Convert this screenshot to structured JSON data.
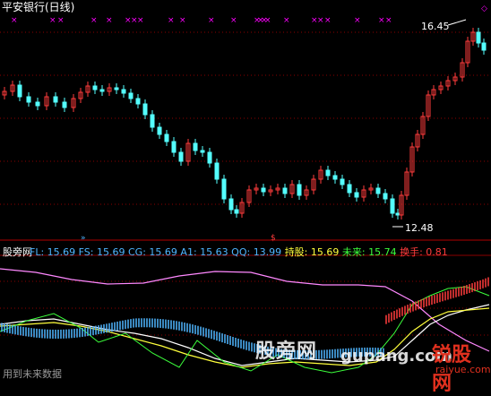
{
  "header": {
    "title": "平安银行(日线)"
  },
  "price_pane": {
    "high_label": "16.45",
    "low_label": "12.48"
  },
  "indicator_pane": {
    "name": "股旁网",
    "items": [
      {
        "label": "FL: ",
        "value": "15.69",
        "color": "#4fb5ff"
      },
      {
        "label": "FS: ",
        "value": "15.69",
        "color": "#4fb5ff"
      },
      {
        "label": "CG: ",
        "value": "15.69",
        "color": "#4fb5ff"
      },
      {
        "label": "A1: ",
        "value": "15.63",
        "color": "#4fb5ff"
      },
      {
        "label": "QQ: ",
        "value": "13.99",
        "color": "#4fb5ff"
      },
      {
        "label": "持股: ",
        "value": "15.69",
        "color": "#ffff3c"
      },
      {
        "label": "未来: ",
        "value": "15.74",
        "color": "#3cff3c"
      },
      {
        "label": "换手: ",
        "value": "0.81",
        "color": "#ff3c3c"
      }
    ]
  },
  "watermarks": {
    "site_cn": "股旁网",
    "site_url": "gupang.com",
    "logo_text": "锐股网",
    "logo_url": "raiyue.com"
  },
  "footer": {
    "text": "用到未来数据"
  },
  "colors": {
    "up": "#ff3c3c",
    "down": "#54ffff",
    "cross": "#ff00ff",
    "background": "#000000",
    "grid": "#8b0000"
  }
}
